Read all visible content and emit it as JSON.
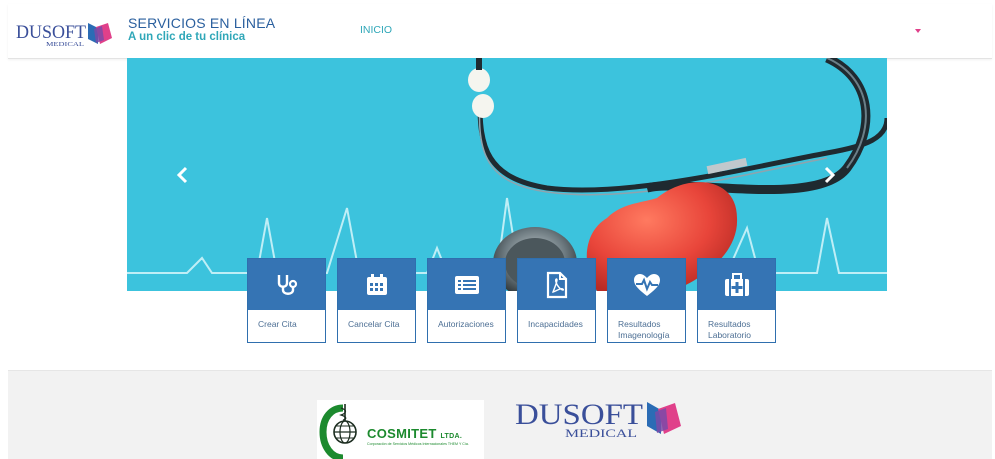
{
  "header": {
    "logo": {
      "word": "DUSOFT",
      "tagline": "MEDICAL"
    },
    "title": "SERVICIOS EN LÍNEA",
    "subtitle": "A un clic de tu clínica",
    "nav": {
      "home_label": "INICIO"
    },
    "user_menu": {
      "icon": "caret-down-icon"
    }
  },
  "carousel": {
    "prev_icon": "chevron-left-icon",
    "next_icon": "chevron-right-icon",
    "background_color": "#3cc3dd"
  },
  "tiles": [
    {
      "label": "Crear Cita",
      "icon": "stethoscope-icon"
    },
    {
      "label": "Cancelar Cita",
      "icon": "calendar-icon"
    },
    {
      "label": "Autorizaciones",
      "icon": "list-document-icon"
    },
    {
      "label": "Incapacidades",
      "icon": "pdf-file-icon"
    },
    {
      "label": "Resultados Imagenología",
      "icon": "heart-pulse-icon"
    },
    {
      "label": "Resultados Laboratorio",
      "icon": "medical-kit-icon"
    }
  ],
  "footer": {
    "partner": {
      "name": "COSMITET",
      "suffix": "LTDA.",
      "tagline": "Corporación de Servicios Médicos Internacionales THEM Y Cía."
    },
    "brand": {
      "word": "DUSOFT",
      "tagline": "MEDICAL"
    }
  },
  "colors": {
    "primary": "#3574b4",
    "accent": "#2fa7b8",
    "brand_pink": "#e0408a",
    "cosmitet_green": "#1c8a2e"
  }
}
